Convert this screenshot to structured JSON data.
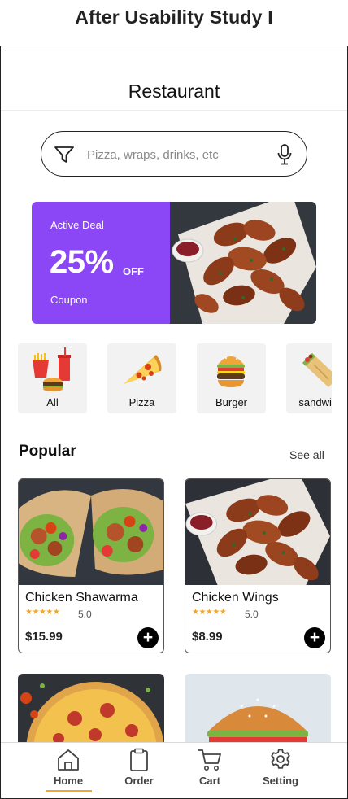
{
  "study_title": "After Usability Study I",
  "header": {
    "title": "Restaurant"
  },
  "search": {
    "placeholder": "Pizza, wraps, drinks, etc"
  },
  "deal": {
    "label": "Active Deal",
    "percent": "25%",
    "off": "OFF",
    "coupon": "Coupon"
  },
  "categories": [
    {
      "label": "All",
      "icon": "fastfood-combo-icon"
    },
    {
      "label": "Pizza",
      "icon": "pizza-slice-icon"
    },
    {
      "label": "Burger",
      "icon": "burger-icon"
    },
    {
      "label": "sandwich",
      "icon": "wrap-sandwich-icon"
    }
  ],
  "popular": {
    "title": "Popular",
    "see_all": "See all",
    "items": [
      {
        "name": "Chicken Shawarma",
        "stars": "★★★★★",
        "rating": "5.0",
        "price": "$15.99",
        "add": "+"
      },
      {
        "name": "Chicken Wings",
        "stars": "★★★★★",
        "rating": "5.0",
        "price": "$8.99",
        "add": "+"
      }
    ]
  },
  "nav": {
    "items": [
      {
        "label": "Home",
        "icon": "home-icon",
        "active": true
      },
      {
        "label": "Order",
        "icon": "clipboard-icon",
        "active": false
      },
      {
        "label": "Cart",
        "icon": "cart-icon",
        "active": false
      },
      {
        "label": "Setting",
        "icon": "gear-icon",
        "active": false
      }
    ]
  },
  "colors": {
    "deal_purple": "#8b47f5",
    "star": "#f5a623",
    "active_indicator": "#f5a623"
  }
}
